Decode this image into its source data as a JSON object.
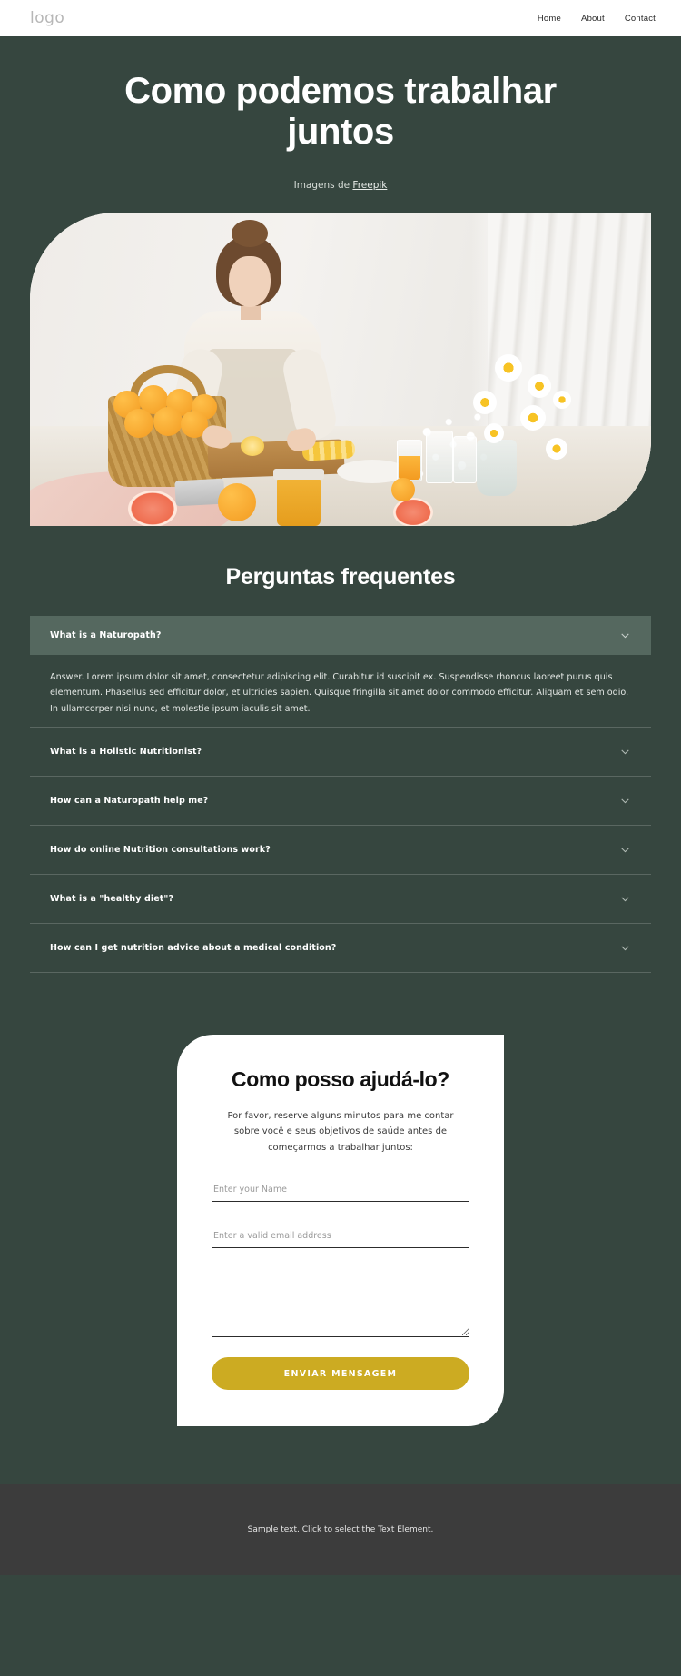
{
  "header": {
    "logo": "logo",
    "nav": [
      {
        "label": "Home"
      },
      {
        "label": "About"
      },
      {
        "label": "Contact"
      }
    ]
  },
  "hero": {
    "title": "Como podemos trabalhar juntos",
    "credit_prefix": "Imagens de ",
    "credit_link": "Freepik"
  },
  "faq": {
    "title": "Perguntas frequentes",
    "items": [
      {
        "question": "What is a Naturopath?",
        "answer": "Answer. Lorem ipsum dolor sit amet, consectetur adipiscing elit. Curabitur id suscipit ex. Suspendisse rhoncus laoreet purus quis elementum. Phasellus sed efficitur dolor, et ultricies sapien. Quisque fringilla sit amet dolor commodo efficitur. Aliquam et sem odio. In ullamcorper nisi nunc, et molestie ipsum iaculis sit amet.",
        "expanded": true
      },
      {
        "question": "What is a Holistic Nutritionist?",
        "expanded": false
      },
      {
        "question": "How can a Naturopath help me?",
        "expanded": false
      },
      {
        "question": "How do online Nutrition consultations work?",
        "expanded": false
      },
      {
        "question": "What is a \"healthy diet\"?",
        "expanded": false
      },
      {
        "question": "How can I get nutrition advice about a medical condition?",
        "expanded": false
      }
    ]
  },
  "contact": {
    "title": "Como posso ajudá-lo?",
    "subtitle": "Por favor, reserve alguns minutos para me contar sobre você e seus objetivos de saúde antes de começarmos a trabalhar juntos:",
    "name_placeholder": "Enter your Name",
    "name_value": "",
    "email_placeholder": "Enter a valid email address",
    "email_value": "",
    "message_placeholder": "",
    "message_value": "",
    "submit_label": "ENVIAR MENSAGEM"
  },
  "footer": {
    "text": "Sample text. Click to select the Text Element."
  },
  "colors": {
    "page_bg": "#36463f",
    "faq_active_bg": "#55685f",
    "accent_button": "#ccab22",
    "footer_bg": "#3c3c3c"
  }
}
